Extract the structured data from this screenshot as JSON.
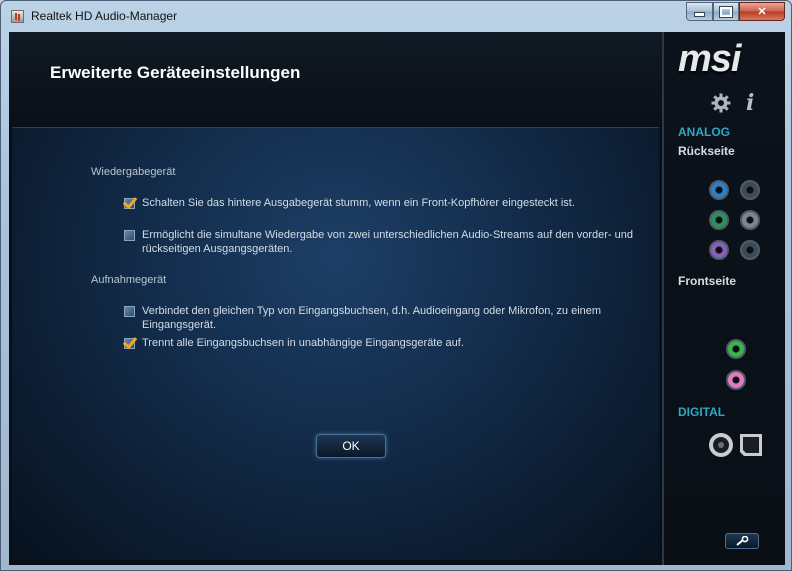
{
  "window": {
    "title": "Realtek HD Audio-Manager"
  },
  "page": {
    "title": "Erweiterte Geräteeinstellungen"
  },
  "playback": {
    "section_title": "Wiedergabegerät",
    "options": [
      {
        "label": "Schalten Sie das hintere Ausgabegerät stumm, wenn ein Front-Kopfhörer eingesteckt ist.",
        "checked": true
      },
      {
        "label": "Ermöglicht die simultane Wiedergabe von zwei unterschiedlichen Audio-Streams auf den vorder- und rückseitigen Ausgangsgeräten.",
        "checked": false
      }
    ]
  },
  "recording": {
    "section_title": "Aufnahmegerät",
    "options": [
      {
        "label": "Verbindet den gleichen Typ von Eingangsbuchsen, d.h. Audioeingang oder Mikrofon, zu einem Eingangsgerät.",
        "checked": false
      },
      {
        "label": "Trennt alle Eingangsbuchsen in unabhängige Eingangsgeräte auf.",
        "checked": true
      }
    ]
  },
  "ok_label": "OK",
  "sidebar": {
    "logo": "msi",
    "analog_label": "ANALOG",
    "back_label": "Rückseite",
    "front_label": "Frontseite",
    "digital_label": "DIGITAL",
    "back_jacks": [
      {
        "color": "#2f7fc4",
        "active": true
      },
      {
        "color": "#3d4a57",
        "active": false
      },
      {
        "color": "#2f8f5b",
        "active": true
      },
      {
        "color": "#7b8590",
        "active": true
      },
      {
        "color": "#8a5fb5",
        "active": true
      },
      {
        "color": "#3d4a57",
        "active": false
      }
    ],
    "front_jacks": [
      {
        "color": "#3cb34a"
      },
      {
        "color": "#e27bc2"
      }
    ]
  },
  "colors": {
    "accent": "#2ea9c2",
    "check": "#f2a623",
    "background": "#0a0f16"
  }
}
